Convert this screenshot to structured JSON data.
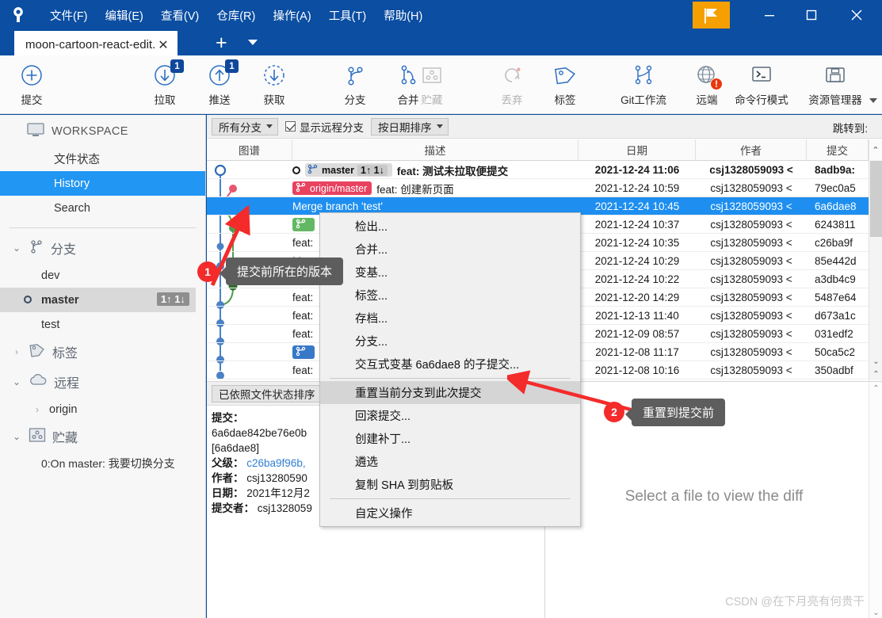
{
  "window": {
    "title_menu": [
      "文件(F)",
      "编辑(E)",
      "查看(V)",
      "仓库(R)",
      "操作(A)",
      "工具(T)",
      "帮助(H)"
    ],
    "minimize": "—",
    "maximize": "□",
    "close": "✕"
  },
  "tab": {
    "label": "moon-cartoon-react-edit.",
    "close": "✕",
    "add": "+"
  },
  "toolbar": {
    "items": [
      {
        "name": "commit",
        "label": "提交",
        "icon": "plus-circle-icon",
        "badge": "",
        "disabled": false
      },
      {
        "name": "pull",
        "label": "拉取",
        "icon": "arrow-down-circle-icon",
        "badge": "1",
        "disabled": false
      },
      {
        "name": "push",
        "label": "推送",
        "icon": "arrow-up-circle-icon",
        "badge": "1",
        "disabled": false
      },
      {
        "name": "fetch",
        "label": "获取",
        "icon": "fetch-dashed-icon",
        "badge": "",
        "disabled": false
      },
      {
        "name": "branch",
        "label": "分支",
        "icon": "branch-icon",
        "badge": "",
        "disabled": false
      },
      {
        "name": "merge",
        "label": "合并",
        "icon": "merge-icon",
        "badge": "",
        "disabled": false
      },
      {
        "name": "stash",
        "label": "贮藏",
        "icon": "stash-icon",
        "badge": "",
        "disabled": true
      },
      {
        "name": "discard",
        "label": "丢弃",
        "icon": "discard-icon",
        "badge": "",
        "disabled": true
      },
      {
        "name": "tag",
        "label": "标签",
        "icon": "tag-icon",
        "badge": "",
        "disabled": false
      },
      {
        "name": "gitflow",
        "label": "Git工作流",
        "icon": "gitflow-icon",
        "badge": "",
        "disabled": false
      },
      {
        "name": "remote",
        "label": "远端",
        "icon": "globe-icon",
        "badge": "!",
        "disabled": false
      },
      {
        "name": "terminal",
        "label": "命令行模式",
        "icon": "terminal-icon",
        "badge": "",
        "disabled": false
      },
      {
        "name": "explorer",
        "label": "资源管理器",
        "icon": "folder-icon",
        "badge": "",
        "disabled": false
      }
    ]
  },
  "sidebar": {
    "workspace_label": "WORKSPACE",
    "workspace_items": [
      {
        "label": "文件状态",
        "selected": false
      },
      {
        "label": "History",
        "selected": true
      },
      {
        "label": "Search",
        "selected": false
      }
    ],
    "branches": {
      "group_label": "分支",
      "expanded": "⌄",
      "items": [
        {
          "label": "dev",
          "active": false,
          "aheadbehind": ""
        },
        {
          "label": "master",
          "active": true,
          "aheadbehind": "1↑ 1↓"
        },
        {
          "label": "test",
          "active": false,
          "aheadbehind": ""
        }
      ]
    },
    "tags": {
      "group_label": "标签",
      "collapsed": "›"
    },
    "remotes": {
      "group_label": "远程",
      "expanded": "⌄",
      "items": [
        {
          "label": "origin",
          "collapsed": "›"
        }
      ]
    },
    "stashes": {
      "group_label": "贮藏",
      "expanded": "⌄",
      "items": [
        {
          "label": "0:On master: 我要切换分支"
        }
      ]
    }
  },
  "filterbar": {
    "branch_filter": "所有分支",
    "show_remote_label": "显示远程分支",
    "show_remote_checked": true,
    "sort_filter": "按日期排序",
    "jump_to_label": "跳转到:"
  },
  "table": {
    "columns": [
      "图谱",
      "描述",
      "日期",
      "作者",
      "提交"
    ],
    "rows": [
      {
        "refs": [
          {
            "type": "local",
            "label": "master",
            "ab": "1↑ 1↓"
          }
        ],
        "open_dot": true,
        "desc": "feat: 测试未拉取便提交",
        "date": "2021-12-24 11:06",
        "author": "csj1328059093 <",
        "sha": "8adb9a:",
        "bold": true,
        "selected": false
      },
      {
        "refs": [
          {
            "type": "pink",
            "label": "origin/master",
            "ab": ""
          }
        ],
        "open_dot": false,
        "desc": "feat: 创建新页面",
        "date": "2021-12-24 10:59",
        "author": "csj1328059093 <",
        "sha": "79ec0a5",
        "bold": false,
        "selected": false
      },
      {
        "refs": [],
        "open_dot": false,
        "desc": "Merge branch 'test'",
        "date": "2021-12-24 10:45",
        "author": "csj1328059093 <",
        "sha": "6a6dae8",
        "bold": false,
        "selected": true
      },
      {
        "refs": [
          {
            "type": "green",
            "label": "",
            "ab": ""
          }
        ],
        "open_dot": false,
        "desc": "",
        "date": "2021-12-24 10:37",
        "author": "csj1328059093 <",
        "sha": "6243811",
        "bold": false,
        "selected": false
      },
      {
        "refs": [],
        "open_dot": false,
        "desc": "feat:",
        "date": "2021-12-24 10:35",
        "author": "csj1328059093 <",
        "sha": "c26ba9f",
        "bold": false,
        "selected": false
      },
      {
        "refs": [],
        "open_dot": false,
        "desc": "Mer",
        "date": "2021-12-24 10:29",
        "author": "csj1328059093 <",
        "sha": "85e442d",
        "bold": false,
        "selected": false
      },
      {
        "refs": [],
        "open_dot": false,
        "desc": "feat:",
        "date": "2021-12-24 10:22",
        "author": "csj1328059093 <",
        "sha": "a3db4c9",
        "bold": false,
        "selected": false
      },
      {
        "refs": [],
        "open_dot": false,
        "desc": "feat:",
        "date": "2021-12-20 14:29",
        "author": "csj1328059093 <",
        "sha": "5487e64",
        "bold": false,
        "selected": false
      },
      {
        "refs": [],
        "open_dot": false,
        "desc": "feat:",
        "date": "2021-12-13 11:40",
        "author": "csj1328059093 <",
        "sha": "d673a1c",
        "bold": false,
        "selected": false
      },
      {
        "refs": [],
        "open_dot": false,
        "desc": "feat:",
        "date": "2021-12-09 08:57",
        "author": "csj1328059093 <",
        "sha": "031edf2",
        "bold": false,
        "selected": false
      },
      {
        "refs": [
          {
            "type": "blue",
            "label": "",
            "ab": ""
          }
        ],
        "open_dot": false,
        "desc": "",
        "date": "2021-12-08 11:17",
        "author": "csj1328059093 <",
        "sha": "50ca5c2",
        "bold": false,
        "selected": false
      },
      {
        "refs": [],
        "open_dot": false,
        "desc": "feat:",
        "date": "2021-12-08 10:16",
        "author": "csj1328059093 <",
        "sha": "350adbf",
        "bold": false,
        "selected": false
      }
    ]
  },
  "contextmenu": {
    "items": [
      {
        "label": "检出...",
        "highlight": false,
        "sep_after": false
      },
      {
        "label": "合并...",
        "highlight": false,
        "sep_after": false
      },
      {
        "label": "变基...",
        "highlight": false,
        "sep_after": false
      },
      {
        "label": "标签...",
        "highlight": false,
        "sep_after": false
      },
      {
        "label": "存档...",
        "highlight": false,
        "sep_after": false
      },
      {
        "label": "分支...",
        "highlight": false,
        "sep_after": false
      },
      {
        "label": "交互式变基 6a6dae8 的子提交...",
        "highlight": false,
        "sep_after": true
      },
      {
        "label": "重置当前分支到此次提交",
        "highlight": true,
        "sep_after": false
      },
      {
        "label": "回滚提交...",
        "highlight": false,
        "sep_after": false
      },
      {
        "label": "创建补丁...",
        "highlight": false,
        "sep_after": false
      },
      {
        "label": "遴选",
        "highlight": false,
        "sep_after": false
      },
      {
        "label": "复制 SHA 到剪贴板",
        "highlight": false,
        "sep_after": true
      },
      {
        "label": "自定义操作",
        "highlight": false,
        "sep_after": false
      }
    ]
  },
  "detail": {
    "sort_label": "已依照文件状态排序",
    "commit_key": "提交：",
    "commit_value": "6a6dae842be76e0b",
    "short_sha": "[6a6dae8]",
    "parent_key": "父级：",
    "parent_value": "c26ba9f96b,",
    "author_key": "作者：",
    "author_value": "csj13280590",
    "date_key": "日期：",
    "date_value": "2021年12月2",
    "committer_key": "提交者：",
    "committer_value": "csj1328059"
  },
  "diff": {
    "empty_text": "Select a file to view the diff",
    "watermark": "CSDN @在下月亮有何贵干"
  },
  "annotations": [
    {
      "number": "1",
      "text": "提交前所在的版本"
    },
    {
      "number": "2",
      "text": "重置到提交前"
    }
  ],
  "colors": {
    "titlebar": "#0b4ea2",
    "accent_selected": "#1e8ff0",
    "sidebar_selected": "#2196f3",
    "flag_button": "#f5a000",
    "annotation_badge": "#f42b2b",
    "annotation_bg": "#5d5d5d",
    "arrow_red": "#f42b2b"
  }
}
